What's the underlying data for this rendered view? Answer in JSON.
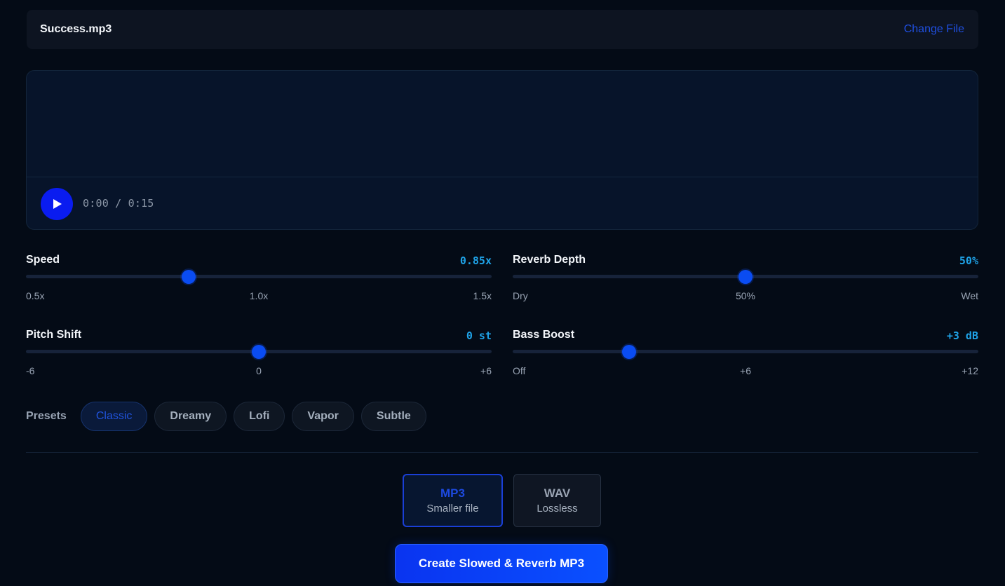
{
  "file": {
    "name": "Success.mp3",
    "change_label": "Change File"
  },
  "player": {
    "time_readout": "0:00 / 0:15",
    "play_icon": "play-icon"
  },
  "controls": {
    "speed": {
      "label": "Speed",
      "value_text": "0.85x",
      "value": 0.85,
      "min": 0.5,
      "max": 1.5,
      "ticks": [
        "0.5x",
        "1.0x",
        "1.5x"
      ]
    },
    "reverb": {
      "label": "Reverb Depth",
      "value_text": "50%",
      "value": 50,
      "min": 0,
      "max": 100,
      "ticks": [
        "Dry",
        "50%",
        "Wet"
      ]
    },
    "pitch": {
      "label": "Pitch Shift",
      "value_text": "0 st",
      "value": 0,
      "min": -6,
      "max": 6,
      "ticks": [
        "-6",
        "0",
        "+6"
      ]
    },
    "bass": {
      "label": "Bass Boost",
      "value_text": "+3 dB",
      "value": 3,
      "min": 0,
      "max": 12,
      "ticks": [
        "Off",
        "+6",
        "+12"
      ]
    }
  },
  "presets": {
    "label": "Presets",
    "items": [
      "Classic",
      "Dreamy",
      "Lofi",
      "Vapor",
      "Subtle"
    ],
    "active": "Classic"
  },
  "format": {
    "mp3": {
      "title": "MP3",
      "subtitle": "Smaller file"
    },
    "wav": {
      "title": "WAV",
      "subtitle": "Lossless"
    },
    "selected": "MP3"
  },
  "create_label": "Create Slowed & Reverb MP3",
  "colors": {
    "background": "#040b16",
    "accent": "#0a4cf2",
    "value_text": "#1fa3e8",
    "link": "#1f4fe0"
  }
}
